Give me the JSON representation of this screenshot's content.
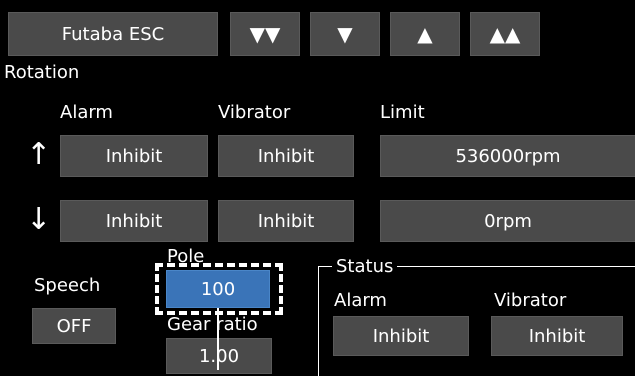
{
  "toolbar": {
    "title_label": "Futaba ESC",
    "buttons": [
      {
        "label": "▼▼",
        "icon": "double-down-icon"
      },
      {
        "label": "▼",
        "icon": "down-icon"
      },
      {
        "label": "▲",
        "icon": "up-icon"
      },
      {
        "label": "▲▲",
        "icon": "double-up-icon"
      }
    ]
  },
  "section_title": "Rotation",
  "columns": {
    "alarm": "Alarm",
    "vibrator": "Vibrator",
    "limit": "Limit"
  },
  "rows": {
    "up": {
      "arrow": "↑",
      "alarm": "Inhibit",
      "vibrator": "Inhibit",
      "limit": "536000rpm"
    },
    "down": {
      "arrow": "↓",
      "alarm": "Inhibit",
      "vibrator": "Inhibit",
      "limit": "0rpm"
    }
  },
  "speech": {
    "label": "Speech",
    "value": "OFF"
  },
  "pole": {
    "label": "Pole",
    "value": "100"
  },
  "gear_ratio": {
    "label": "Gear ratio",
    "value": "1.00"
  },
  "status": {
    "title": "Status",
    "alarm_label": "Alarm",
    "vibrator_label": "Vibrator",
    "alarm_value": "Inhibit",
    "vibrator_value": "Inhibit"
  },
  "colors": {
    "background": "#000000",
    "button": "#4a4a4a",
    "selected": "#3a74b8"
  }
}
